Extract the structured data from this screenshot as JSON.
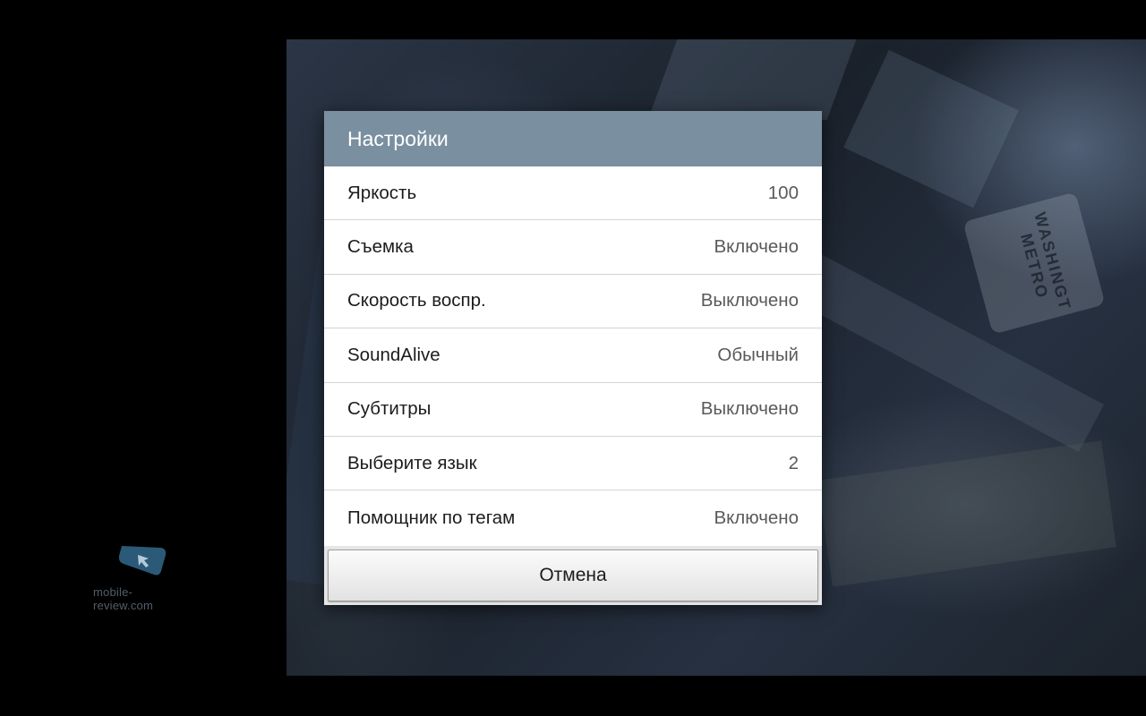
{
  "dialog": {
    "title": "Настройки",
    "items": [
      {
        "label": "Яркость",
        "value": "100"
      },
      {
        "label": "Съемка",
        "value": "Включено"
      },
      {
        "label": "Скорость воспр.",
        "value": "Выключено"
      },
      {
        "label": "SoundAlive",
        "value": "Обычный"
      },
      {
        "label": "Субтитры",
        "value": "Выключено"
      },
      {
        "label": "Выберите язык",
        "value": "2"
      },
      {
        "label": "Помощник по тегам",
        "value": "Включено"
      }
    ],
    "cancel_label": "Отмена"
  },
  "video": {
    "sign_text": "WASHINGT METRO"
  },
  "watermark": {
    "text": "mobile-review.com"
  },
  "colors": {
    "header": "#7a8fa0",
    "dialog_bg": "#ffffff",
    "divider": "#d4d4d4"
  }
}
